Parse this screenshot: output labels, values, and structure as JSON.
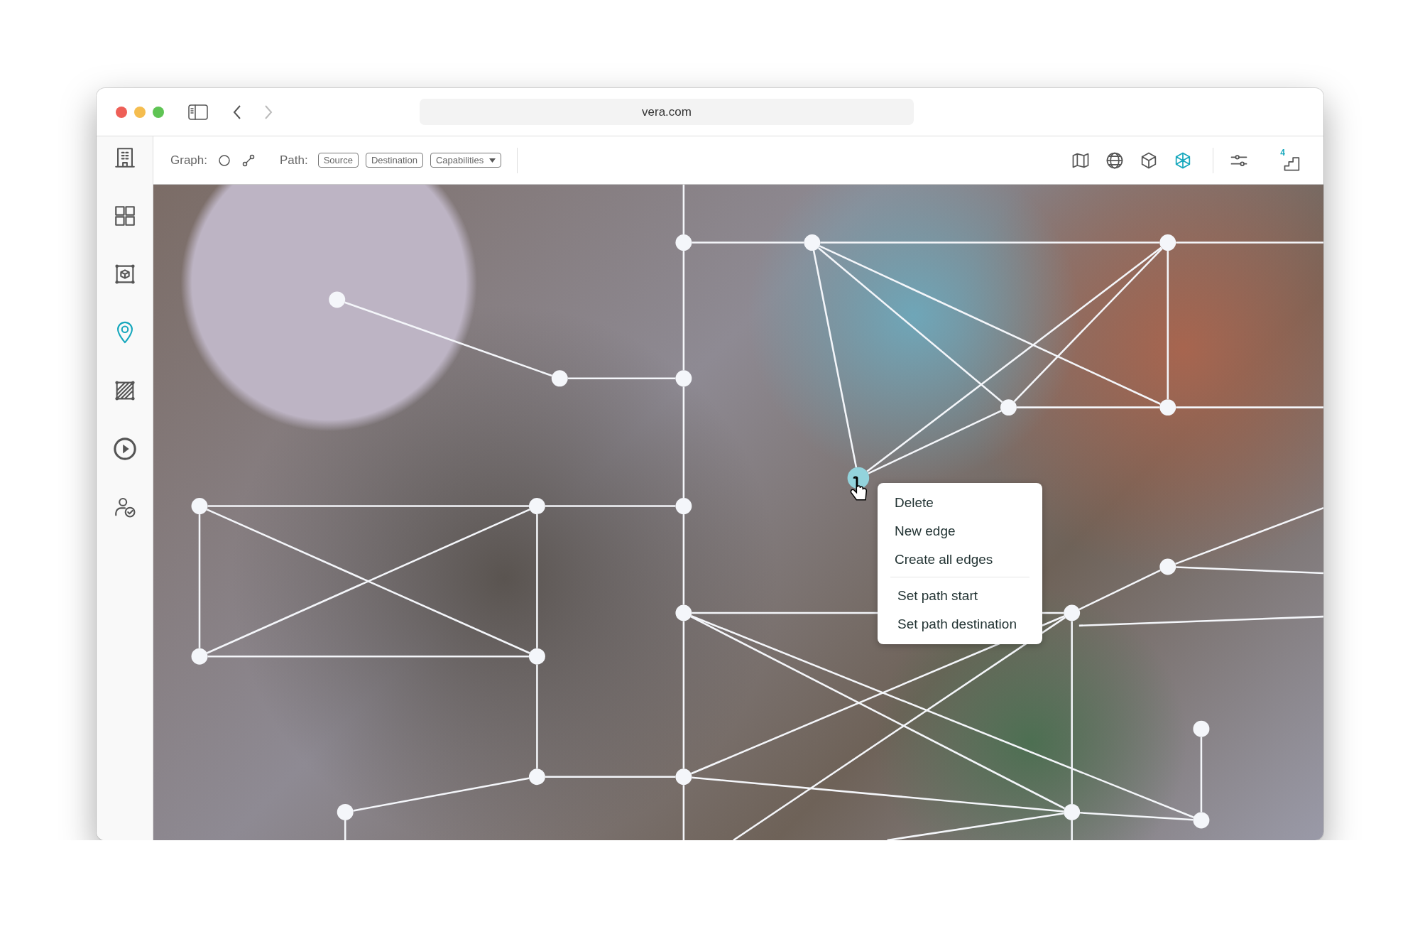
{
  "browser": {
    "address": "vera.com",
    "back_enabled": true,
    "forward_enabled": false
  },
  "toolbar": {
    "graph_label": "Graph:",
    "path_label": "Path:",
    "path_buttons": [
      {
        "label": "Source",
        "kind": "button"
      },
      {
        "label": "Destination",
        "kind": "button"
      },
      {
        "label": "Capabilities",
        "kind": "dropdown"
      }
    ],
    "view_modes": [
      {
        "kind": "map",
        "selected": false
      },
      {
        "kind": "globe",
        "selected": false
      },
      {
        "kind": "cube",
        "selected": false
      },
      {
        "kind": "wire-cube",
        "selected": true
      }
    ],
    "floor_badge": "4"
  },
  "sidebar": {
    "items": [
      {
        "kind": "building",
        "selected": false
      },
      {
        "kind": "grid",
        "selected": false
      },
      {
        "kind": "box-frame",
        "selected": false
      },
      {
        "kind": "pin",
        "selected": true
      },
      {
        "kind": "hatch",
        "selected": false
      },
      {
        "kind": "play",
        "selected": false
      },
      {
        "kind": "user-check",
        "selected": false
      }
    ]
  },
  "context_menu": {
    "sections": [
      [
        "Delete",
        "New edge",
        "Create all edges"
      ],
      [
        "Set path start",
        "Set path destination"
      ]
    ]
  }
}
